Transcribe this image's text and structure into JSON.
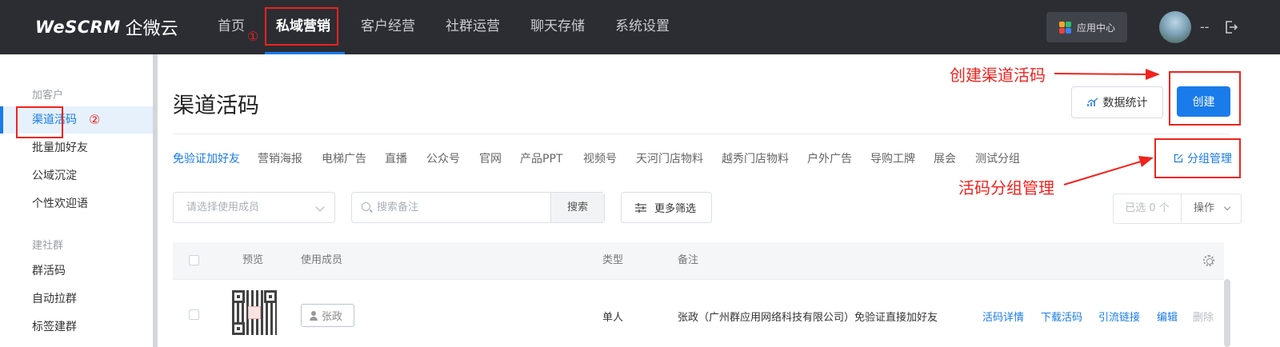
{
  "brand": {
    "logo_text": "WeSCRM",
    "product_name": "企微云"
  },
  "nav": {
    "items": [
      {
        "label": "首页"
      },
      {
        "label": "私域营销",
        "active": true
      },
      {
        "label": "客户经营"
      },
      {
        "label": "社群运营"
      },
      {
        "label": "聊天存储"
      },
      {
        "label": "系统设置"
      }
    ],
    "app_center": "应用中心",
    "user_dropdown": "--"
  },
  "sidebar": {
    "groups": [
      {
        "title": "加客户",
        "items": [
          {
            "label": "渠道活码",
            "active": true
          },
          {
            "label": "批量加好友"
          },
          {
            "label": "公域沉淀"
          },
          {
            "label": "个性欢迎语"
          }
        ]
      },
      {
        "title": "建社群",
        "items": [
          {
            "label": "群活码"
          },
          {
            "label": "自动拉群"
          },
          {
            "label": "标签建群"
          }
        ]
      }
    ]
  },
  "page": {
    "title": "渠道活码",
    "stats_button": "数据统计",
    "create_button": "创建",
    "group_management": "分组管理",
    "tabs": [
      "免验证加好友",
      "营销海报",
      "电梯广告",
      "直播",
      "公众号",
      "官网",
      "产品PPT",
      "视频号",
      "天河门店物料",
      "越秀门店物料",
      "户外广告",
      "导购工牌",
      "展会",
      "测试分组"
    ],
    "filters": {
      "member_placeholder": "请选择使用成员",
      "search_placeholder": "搜索备注",
      "search_button": "搜索",
      "more_filters": "更多筛选",
      "selected_count": "已选 0 个",
      "operations": "操作"
    },
    "table": {
      "headers": {
        "preview": "预览",
        "member": "使用成员",
        "type": "类型",
        "remark": "备注"
      },
      "rows": [
        {
          "member": "张政",
          "type": "单人",
          "remark": "张政（广州群应用网络科技有限公司）免验证直接加好友",
          "actions": [
            "活码详情",
            "下载活码",
            "引流链接",
            "编辑",
            "删除"
          ]
        }
      ]
    }
  },
  "annotations": {
    "step1": "①",
    "step2": "②",
    "create_hint": "创建渠道活码",
    "group_hint": "活码分组管理",
    "color": "#f0231e"
  },
  "colors": {
    "accent": "#1a7bea",
    "topbar": "#2b2d33"
  }
}
